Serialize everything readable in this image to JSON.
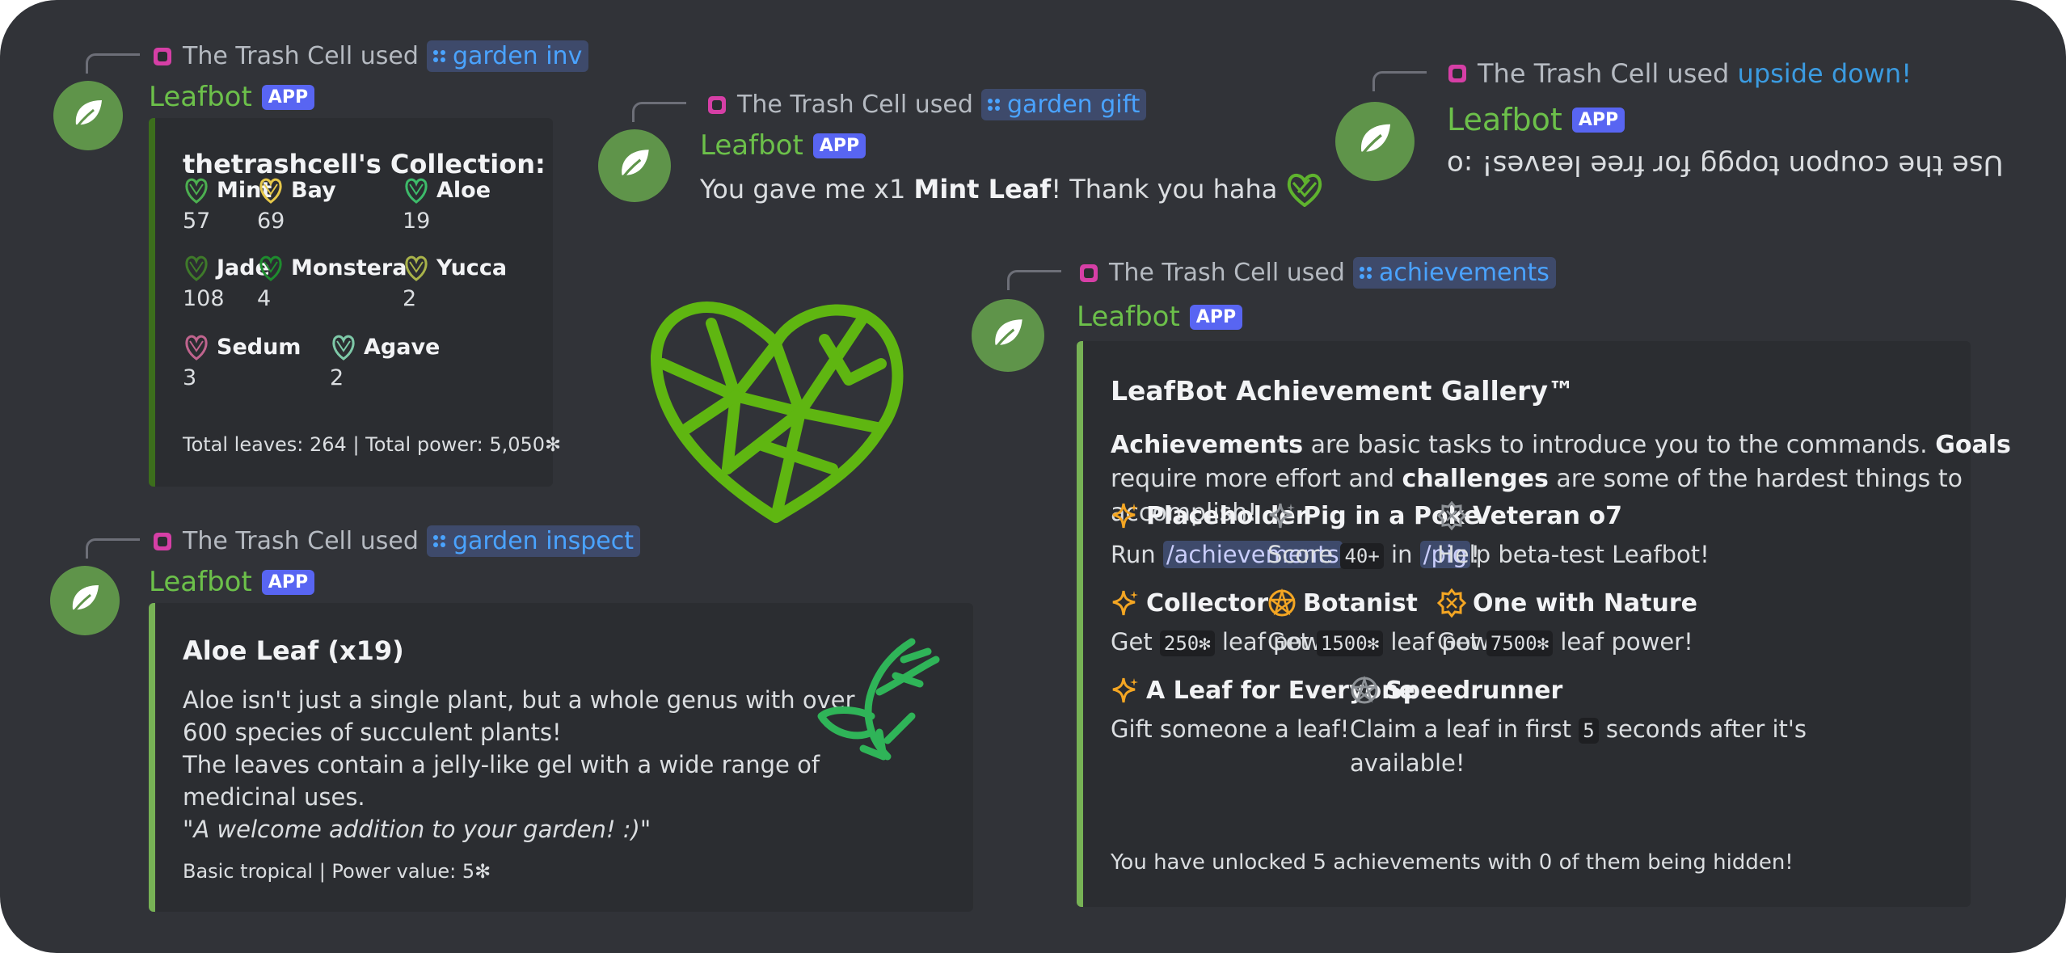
{
  "colors": {
    "background": "#313338",
    "embed_bg": "#2b2d31",
    "bot_name": "#6cc04a",
    "app_badge": "#5865f2",
    "command": "#4aa3ff",
    "accent_green": "#77b255",
    "accent_dark_green": "#3c6e1c",
    "star_gold": "#f4a623"
  },
  "bot": {
    "name": "Leafbot",
    "badge": "APP"
  },
  "user": {
    "name": "The Trash Cell",
    "used": "used"
  },
  "inv": {
    "command": "garden inv",
    "title": "thetrashcell's Collection:",
    "plants": [
      {
        "name": "Mint",
        "count": "57",
        "icon": "mint-leaf-icon",
        "color": "#4caf50"
      },
      {
        "name": "Bay",
        "count": "69",
        "icon": "bay-leaf-icon",
        "color": "#e6c84a"
      },
      {
        "name": "Aloe",
        "count": "19",
        "icon": "aloe-leaf-icon",
        "color": "#3dbb6a"
      },
      {
        "name": "Jade",
        "count": "108",
        "icon": "jade-leaf-icon",
        "color": "#3f7a2a"
      },
      {
        "name": "Monstera",
        "count": "4",
        "icon": "monstera-leaf-icon",
        "color": "#1e8c2e"
      },
      {
        "name": "Yucca",
        "count": "2",
        "icon": "yucca-leaf-icon",
        "color": "#a9b34a"
      },
      {
        "name": "Sedum",
        "count": "3",
        "icon": "sedum-leaf-icon",
        "color": "#c0648e"
      },
      {
        "name": "Agave",
        "count": "2",
        "icon": "agave-leaf-icon",
        "color": "#7ec9a8"
      }
    ],
    "footer": "Total leaves: 264 | Total power: 5,050✻"
  },
  "gift": {
    "command": "garden gift",
    "message_pre": "You gave me x1 ",
    "message_bold": "Mint Leaf",
    "message_post": "! Thank you haha"
  },
  "upside": {
    "command": "upside down!",
    "message": "Use the coupon topgg for free leaves! :o"
  },
  "inspect": {
    "command": "garden inspect",
    "title": "Aloe Leaf (x19)",
    "line1": "Aloe isn't just a single plant, but a whole genus with over",
    "line2": "600 species of succulent plants!",
    "line3": "The leaves contain a jelly-like gel with a wide range of",
    "line4": "medicinal uses.",
    "quote": "\"A welcome addition to your garden! :)\"",
    "footer": "Basic tropical | Power value: 5✻"
  },
  "ach": {
    "command": "achievements",
    "title": "LeafBot Achievement Gallery™",
    "intro_b1": "Achievements",
    "intro_t1": " are basic tasks to introduce you to the commands. ",
    "intro_b2": "Goals",
    "intro_t2": "require more effort and ",
    "intro_b3": "challenges",
    "intro_t3": " are some of the hardest things to",
    "intro_t4": "accomplish!",
    "items": [
      {
        "title": "Placeholder",
        "icon": "sparkle-gold-icon",
        "d_pre": "Run ",
        "d_link": "/achievements",
        "d_post": "!"
      },
      {
        "title": "Pig in a Poke",
        "icon": "sparkle-gray-icon",
        "d_pre": "Score ",
        "d_code": "40+",
        "d_mid": " in ",
        "d_link": "/pig",
        "d_post": "!"
      },
      {
        "title": "Veteran o7",
        "icon": "gear-gray-icon",
        "d_pre": "Help beta-test Leafbot!"
      },
      {
        "title": "Collector",
        "icon": "sparkle-gold-icon",
        "d_pre": "Get ",
        "d_code": "250✻",
        "d_post": " leaf power!"
      },
      {
        "title": "Botanist",
        "icon": "pentagram-gold-icon",
        "d_pre": "Get ",
        "d_code": "1500✻",
        "d_post": " leaf power!"
      },
      {
        "title": "One with Nature",
        "icon": "gear-gold-icon",
        "d_pre": "Get ",
        "d_code": "7500✻",
        "d_post": " leaf power!"
      },
      {
        "title": "A Leaf for Everyone",
        "icon": "sparkle-gold-icon",
        "d_pre": "Gift someone a leaf!"
      },
      {
        "title": "Speedrunner",
        "icon": "pentagram-gray-icon",
        "d_pre": "Claim a leaf in first ",
        "d_code": "5",
        "d_post": " seconds after it's",
        "d_line2": "available!"
      }
    ],
    "footer": "You have unlocked 5 achievements with 0 of them being hidden!"
  }
}
